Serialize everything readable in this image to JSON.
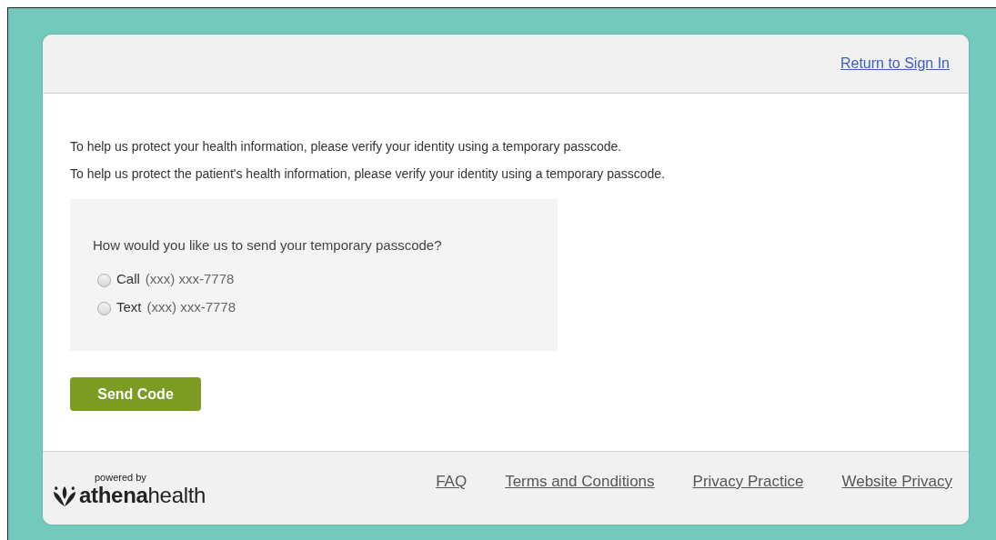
{
  "header": {
    "link": "Return to Sign In"
  },
  "messages": [
    "To help us protect your health information, please verify your identity using a temporary passcode.",
    "To help us protect the patient's health information, please verify your identity using a temporary passcode."
  ],
  "delivery": {
    "question": "How would you like us to send your temporary passcode?",
    "options": [
      {
        "method": "Call",
        "number": "(xxx) xxx-7778",
        "selected": false
      },
      {
        "method": "Text",
        "number": "(xxx) xxx-7778",
        "selected": false
      }
    ]
  },
  "button": "Send Code",
  "footer": {
    "powered_by": "powered by",
    "brand": "**athena**health",
    "links": [
      "FAQ",
      "Terms and Conditions",
      "Privacy Practice",
      "Website Privacy"
    ]
  }
}
